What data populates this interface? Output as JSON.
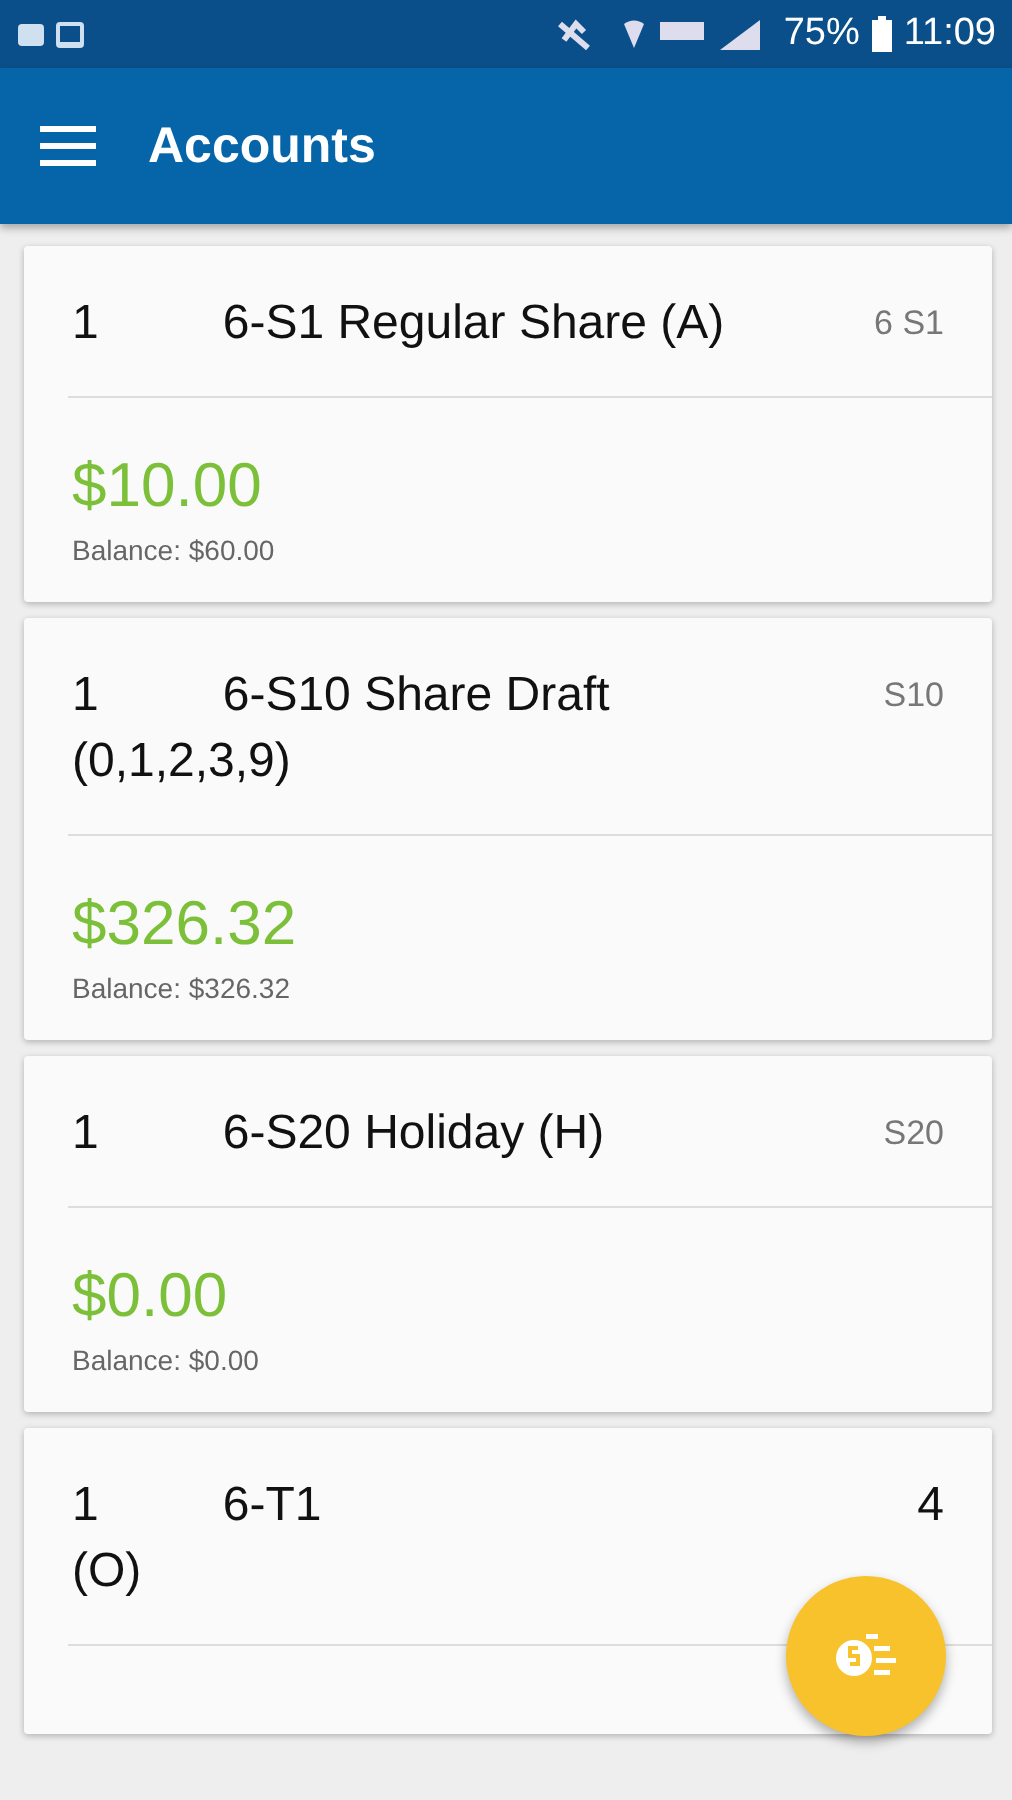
{
  "status_bar": {
    "battery": "75%",
    "time": "11:09"
  },
  "app_bar": {
    "title": "Accounts"
  },
  "accounts": [
    {
      "lines": [
        [
          {
            "kind": "text",
            "text": "1"
          },
          {
            "kind": "gap"
          },
          {
            "kind": "text",
            "text": "6-S1 Regular Share (A)"
          }
        ]
      ],
      "code": "6 S1",
      "amount": "$10.00",
      "balance": "Balance: $60.00"
    },
    {
      "lines": [
        [
          {
            "kind": "text",
            "text": "1"
          },
          {
            "kind": "gap"
          },
          {
            "kind": "text",
            "text": "6-S10 Share Draft"
          }
        ],
        [
          {
            "kind": "text",
            "text": "(0,1,2,3,9)"
          }
        ]
      ],
      "code": "S10",
      "amount": "$326.32",
      "balance": "Balance: $326.32"
    },
    {
      "lines": [
        [
          {
            "kind": "text",
            "text": "1"
          },
          {
            "kind": "gap"
          },
          {
            "kind": "text",
            "text": "6-S20 Holiday (H)"
          }
        ]
      ],
      "code": "S20",
      "amount": "$0.00",
      "balance": "Balance: $0.00"
    },
    {
      "lines": [
        [
          {
            "kind": "text",
            "text": "1"
          },
          {
            "kind": "gap"
          },
          {
            "kind": "text",
            "text": "6-T1"
          },
          {
            "kind": "fill"
          },
          {
            "kind": "text",
            "text": "4"
          }
        ],
        [
          {
            "kind": "text",
            "text": "(O)"
          }
        ]
      ]
    }
  ]
}
